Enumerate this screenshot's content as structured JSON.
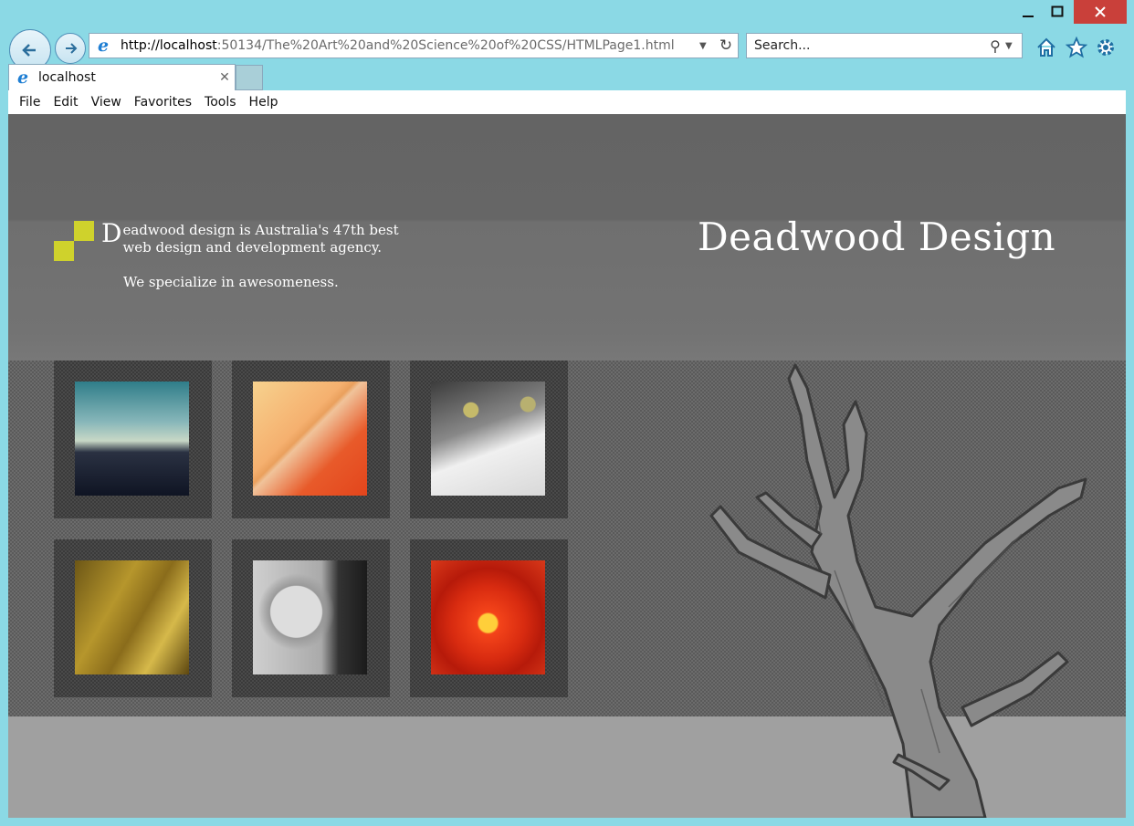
{
  "browser": {
    "address_url_host": "http://localhost",
    "address_url_path": ":50134/The%20Art%20and%20Science%20of%20CSS/HTMLPage1.html",
    "search_placeholder": "Search...",
    "tab_title": "localhost",
    "menu": [
      "File",
      "Edit",
      "View",
      "Favorites",
      "Tools",
      "Help"
    ],
    "icons": [
      "back-icon",
      "forward-icon",
      "ie-logo-icon",
      "refresh-icon",
      "search-icon",
      "home-icon",
      "favorites-star-icon",
      "gear-icon"
    ]
  },
  "site": {
    "brand": "Deadwood Design",
    "intro_dropcap": "D",
    "intro_rest": "eadwood design is Australia's 47th best web design and development agency.",
    "intro_line2": "We specialize in awesomeness.",
    "accent_color": "#cfd22c",
    "gallery": [
      {
        "subject": "coastline-sunset-thumbnail"
      },
      {
        "subject": "orange-fabric-thumbnail"
      },
      {
        "subject": "cat-face-thumbnail"
      },
      {
        "subject": "golden-abstract-thumbnail"
      },
      {
        "subject": "man-with-bottle-thumbnail"
      },
      {
        "subject": "red-flower-thumbnail"
      }
    ]
  }
}
